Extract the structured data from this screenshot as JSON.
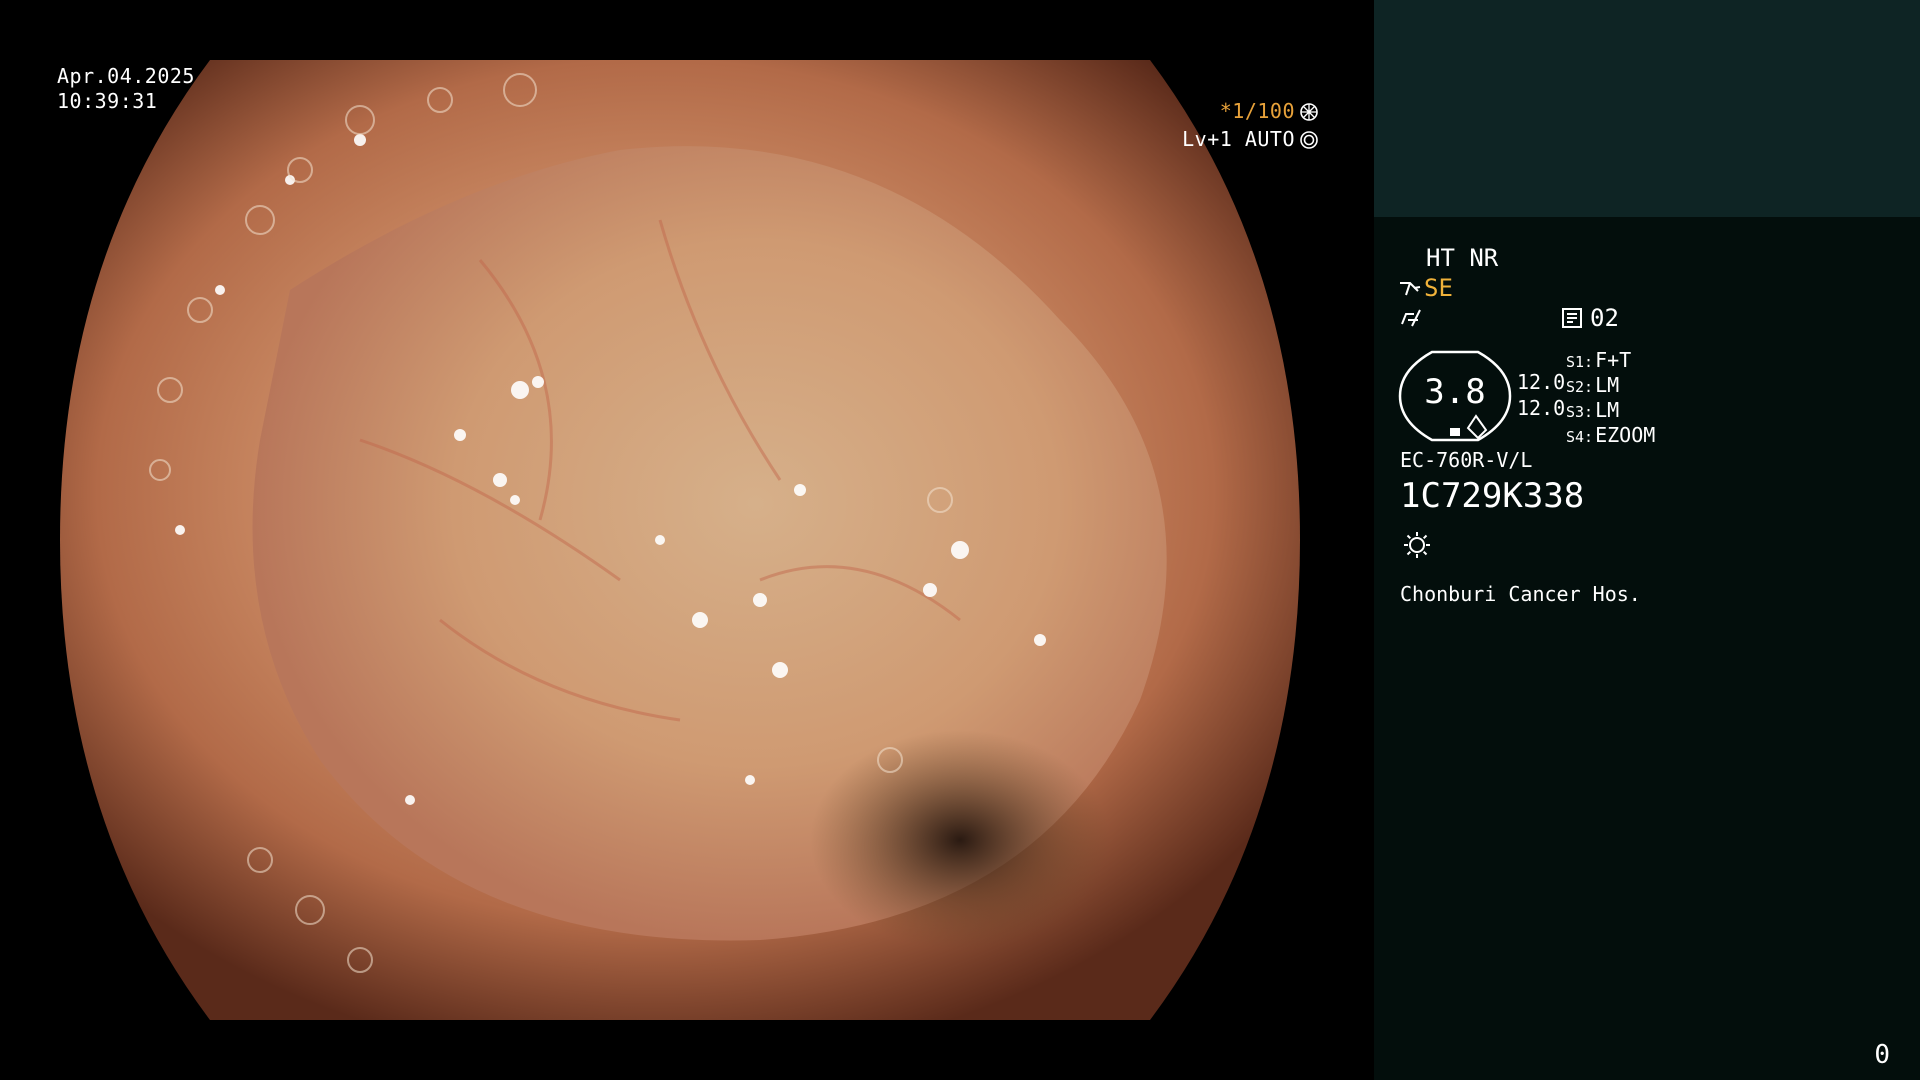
{
  "overlay": {
    "date": "Apr.04.2025",
    "time": "10:39:31",
    "shutter": "*1/100",
    "level": "Lv+1 AUTO",
    "shutter_color": "#e8a23a"
  },
  "panel": {
    "mode": "HT NR",
    "se_label": "SE",
    "se_color": "#f0b23a",
    "card_number": "02",
    "gauge_value": "3.8",
    "value_top": "12.0",
    "value_bottom": "12.0",
    "switches": [
      {
        "label": "S1:",
        "value": "F+T"
      },
      {
        "label": "S2:",
        "value": "LM"
      },
      {
        "label": "S3:",
        "value": "LM"
      },
      {
        "label": "S4:",
        "value": "EZOOM"
      }
    ],
    "scope_model": "EC-760R-V/L",
    "serial": "1C729K338",
    "hospital": "Chonburi Cancer Hos.",
    "counter": "0",
    "icons": [
      "scope-icon",
      "cable-icon",
      "card-icon",
      "light-icon",
      "shutter-wheel-icon",
      "auto-target-icon"
    ],
    "colors": {
      "panel_top": "#0e2424",
      "panel_bottom": "#030e0c",
      "text": "#ffffff"
    }
  }
}
